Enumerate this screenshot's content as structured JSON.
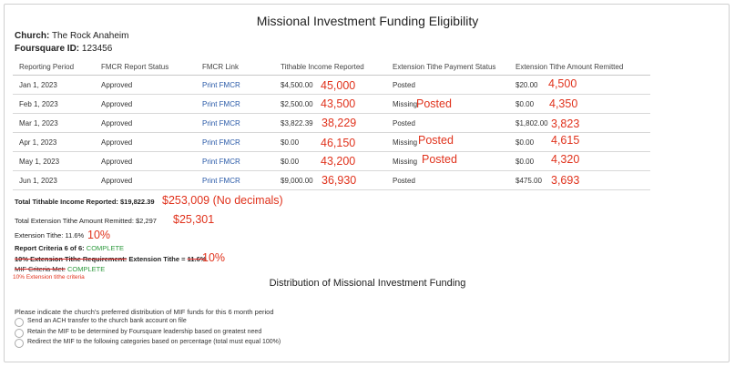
{
  "page_title": "Missional Investment Funding Eligibility",
  "church_label": "Church:",
  "church_value": "The Rock Anaheim",
  "foursquare_label": "Foursquare ID:",
  "foursquare_value": "123456",
  "table": {
    "headers": [
      "Reporting Period",
      "FMCR Report Status",
      "FMCR Link",
      "Tithable Income Reported",
      "Extension Tithe Payment Status",
      "Extension Tithe Amount Remitted"
    ],
    "rows": [
      {
        "period": "Jan 1, 2023",
        "status": "Approved",
        "link": "Print FMCR",
        "income": "$4,500.00",
        "income_note": "45,000",
        "payment": "Posted",
        "payment_note": "",
        "amount": "$20.00",
        "amount_note": "4,500"
      },
      {
        "period": "Feb 1, 2023",
        "status": "Approved",
        "link": "Print FMCR",
        "income": "$2,500.00",
        "income_note": "43,500",
        "payment": "Missing",
        "payment_note": "Posted",
        "amount": "$0.00",
        "amount_note": "4,350"
      },
      {
        "period": "Mar 1, 2023",
        "status": "Approved",
        "link": "Print FMCR",
        "income": "$3,822.39",
        "income_note": "38,229",
        "payment": "Posted",
        "payment_note": "",
        "amount": "$1,802.00",
        "amount_note": "3,823"
      },
      {
        "period": "Apr 1, 2023",
        "status": "Approved",
        "link": "Print FMCR",
        "income": "$0.00",
        "income_note": "46,150",
        "payment": "Missing",
        "payment_note": "Posted",
        "amount": "$0.00",
        "amount_note": "4,615"
      },
      {
        "period": "May 1, 2023",
        "status": "Approved",
        "link": "Print FMCR",
        "income": "$0.00",
        "income_note": "43,200",
        "payment": "Missing",
        "payment_note": "Posted",
        "amount": "$0.00",
        "amount_note": "4,320"
      },
      {
        "period": "Jun 1, 2023",
        "status": "Approved",
        "link": "Print FMCR",
        "income": "$9,000.00",
        "income_note": "36,930",
        "payment": "Posted",
        "payment_note": "",
        "amount": "$475.00",
        "amount_note": "3,693"
      }
    ]
  },
  "summary": {
    "total_income": "Total Tithable Income Reported: $19,822.39",
    "total_income_note": "$253,009 (No decimals)",
    "total_remitted": "Total Extension Tithe Amount Remitted: $2,297",
    "total_remitted_note": "$25,301",
    "extension_tithe": "Extension Tithe: 11.6%",
    "extension_tithe_note": "10%",
    "criteria_label": "Report Criteria 6 of 6:",
    "criteria_status": "COMPLETE",
    "requirement_label": "10% Extension Tithe Requirement:",
    "requirement_text": "Extension Tithe =",
    "requirement_value": "11.6%",
    "requirement_note": "10%",
    "mif_label": "MIF Criteria Met:",
    "mif_status": "COMPLETE",
    "small_note": "10% Extension tithe criteria"
  },
  "distribution": {
    "title": "Distribution of Missional Investment Funding",
    "prompt": "Please indicate the church's preferred distribution of MIF funds for this 6 month period",
    "options": [
      "Send an ACH transfer to the church bank account on file",
      "Retain the MIF to be determined by Foursquare leadership based on greatest need",
      "Redirect the MIF to the following categories based on percentage (total must equal 100%)"
    ]
  },
  "colors": {
    "annotation": "#e0321c",
    "link": "#2a5aa8",
    "complete": "#2e9a3e"
  }
}
